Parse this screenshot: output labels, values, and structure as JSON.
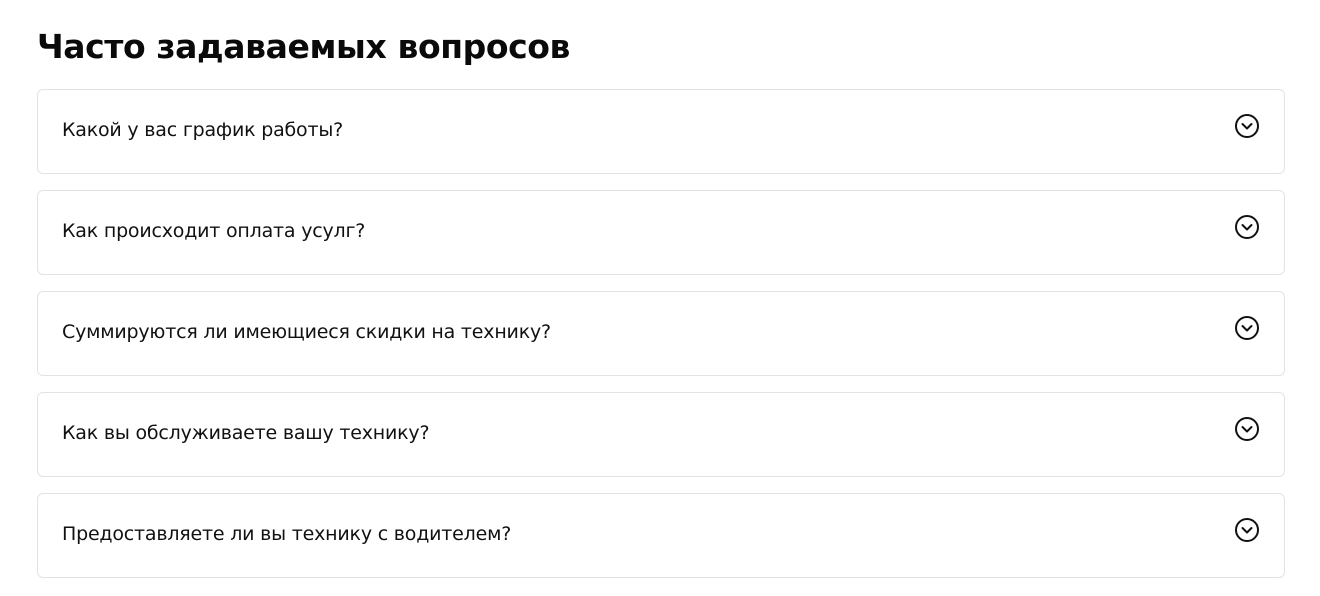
{
  "faq": {
    "title": "Часто задаваемых вопросов",
    "items": [
      {
        "question": "Какой у вас график работы?",
        "icon": "chevron-down-circle-icon"
      },
      {
        "question": "Как происходит оплата усулг?",
        "icon": "chevron-down-circle-icon"
      },
      {
        "question": "Суммируются ли имеющиеся скидки на технику?",
        "icon": "chevron-down-circle-icon"
      },
      {
        "question": "Как вы обслуживаете вашу технику?",
        "icon": "chevron-down-circle-icon"
      },
      {
        "question": "Предоставляете ли вы технику с водителем?",
        "icon": "chevron-down-circle-icon"
      }
    ],
    "colors": {
      "text": "#111111",
      "border": "#e3e3e3",
      "background": "#ffffff"
    }
  }
}
